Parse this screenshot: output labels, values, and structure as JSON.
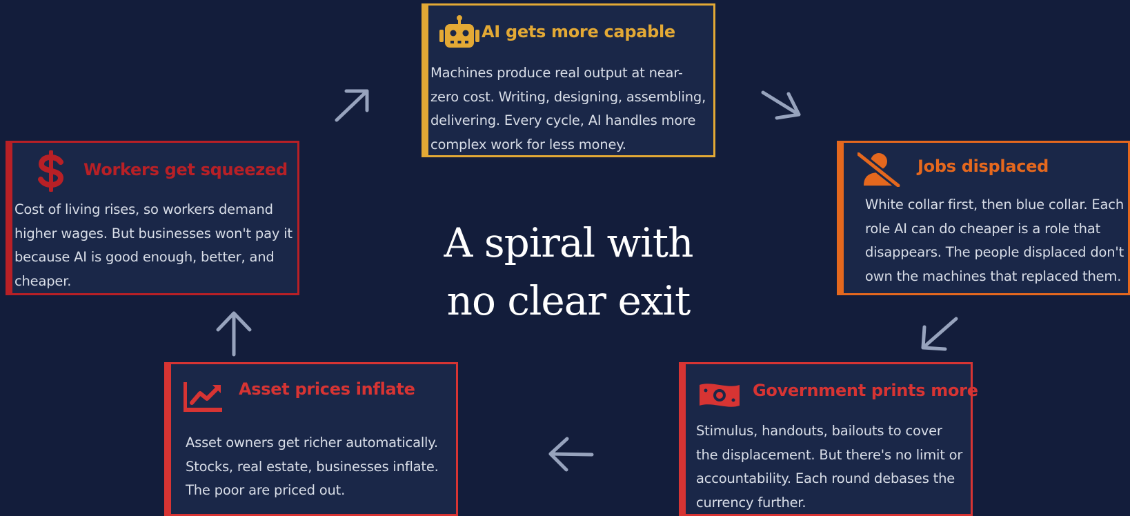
{
  "center": {
    "line1": "A spiral with",
    "line2": "no clear exit"
  },
  "colors": {
    "background": "#131d3b",
    "card_fill": "#1a2748",
    "gold": "#e3a935",
    "orange": "#e5681e",
    "red": "#d73433",
    "dark_red": "#b82026",
    "arrow": "#97a3bd"
  },
  "cards": {
    "ai": {
      "icon": "robot-icon",
      "title": "AI gets more capable",
      "lines": [
        "Machines produce real output at near-",
        "zero cost. Writing, designing, assembling,",
        "delivering. Every cycle, AI handles more",
        "complex work for less money."
      ]
    },
    "jobs": {
      "icon": "user-slash-icon",
      "title": "Jobs displaced",
      "lines": [
        "White collar first, then blue collar. Each",
        "role AI can do cheaper is a role that",
        "disappears. The people displaced don't",
        "own the machines that replaced them."
      ]
    },
    "government": {
      "icon": "money-bill-icon",
      "title": "Government prints more",
      "lines": [
        "Stimulus, handouts, bailouts to cover",
        "the displacement. But there's no limit or",
        "accountability. Each round debases the",
        "currency further."
      ]
    },
    "assets": {
      "icon": "chart-line-icon",
      "title": "Asset prices inflate",
      "lines": [
        "Asset owners get richer automatically.",
        "Stocks, real estate, businesses inflate.",
        "The poor are priced out."
      ]
    },
    "workers": {
      "icon": "dollar-sign-icon",
      "title": "Workers get squeezed",
      "lines": [
        "Cost of living rises, so workers demand",
        "higher wages. But businesses won't pay it",
        "because AI is good enough, better, and",
        "cheaper."
      ]
    }
  }
}
